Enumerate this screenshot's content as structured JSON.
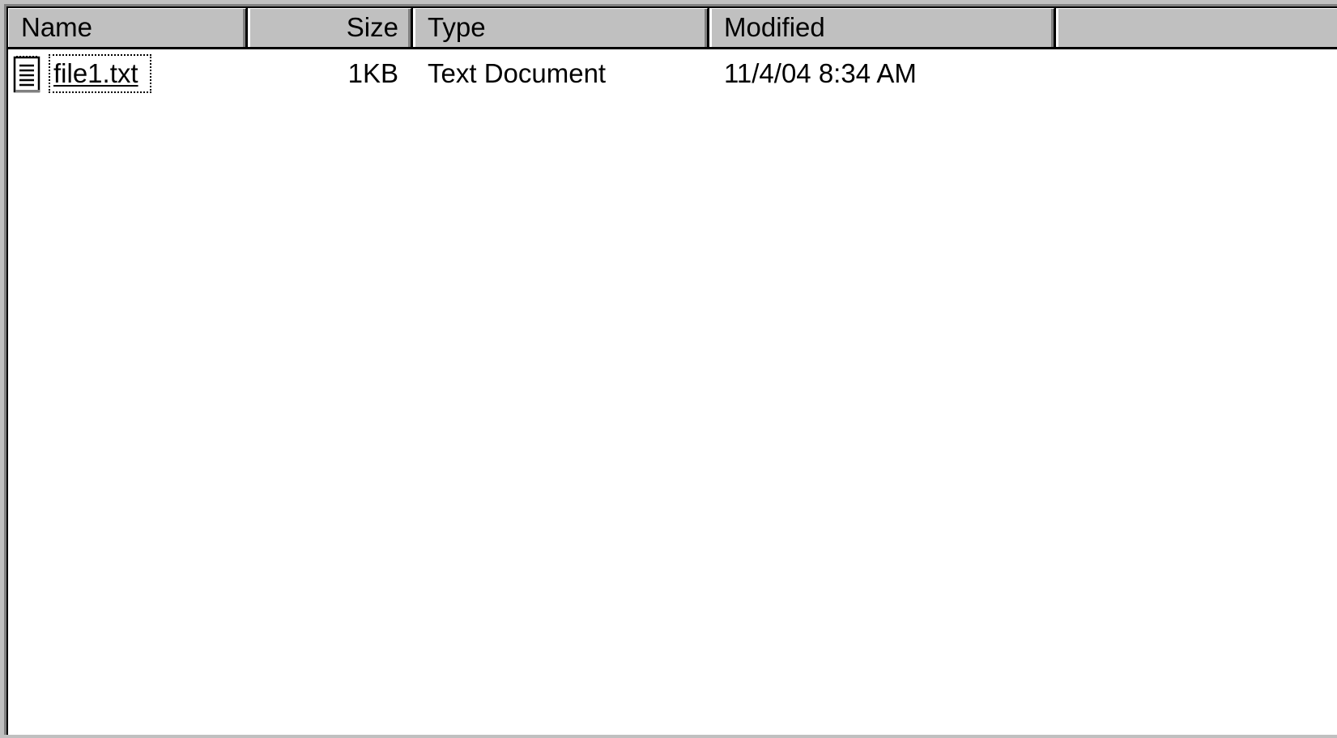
{
  "columns": {
    "name": "Name",
    "size": "Size",
    "type": "Type",
    "modified": "Modified"
  },
  "files": [
    {
      "icon": "text-document-icon",
      "name": "file1.txt",
      "size": "1KB",
      "type": "Text Document",
      "modified": "11/4/04 8:34 AM"
    }
  ]
}
